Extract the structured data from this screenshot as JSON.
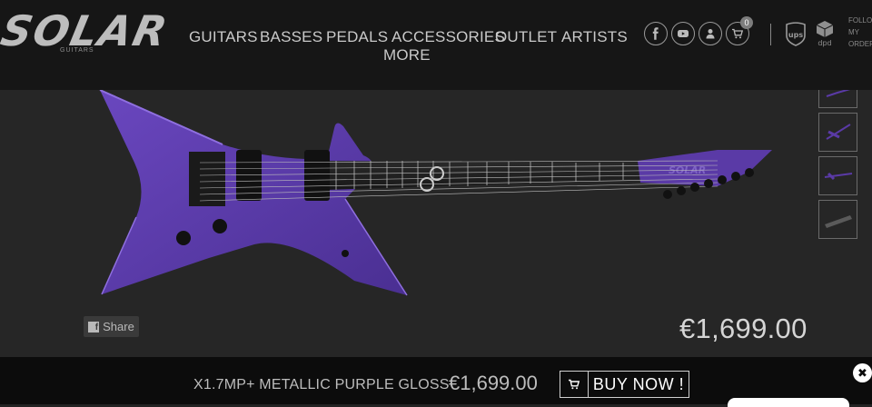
{
  "brand": {
    "logo_text": "SOLAR",
    "logo_sub": "GUITARS"
  },
  "nav": {
    "items": [
      {
        "label": "GUITARS"
      },
      {
        "label": "BASSES"
      },
      {
        "label": "PEDALS"
      },
      {
        "label": "ACCESSORIES"
      },
      {
        "label": "OUTLET"
      },
      {
        "label": "ARTISTS"
      },
      {
        "label": "MORE"
      }
    ]
  },
  "header_icons": [
    "facebook-icon",
    "youtube-icon",
    "user-icon",
    "cart-icon"
  ],
  "cart": {
    "count": "0"
  },
  "shipping": {
    "ups": "ups",
    "dpd": "dpd"
  },
  "follow": {
    "line1": "FOLLO",
    "line2": "MY",
    "line3": "ORDER"
  },
  "product": {
    "name": "X1.7MP+ METALLIC PURPLE GLOSS",
    "price": "€1,699.00",
    "headstock_logo": "SOLAR",
    "guitar_color": "#5a3aa6"
  },
  "share": {
    "label": "Share"
  },
  "cta": {
    "buy_label": "BUY NOW !"
  },
  "colors": {
    "header_bg": "#161616",
    "page_bg": "#262626",
    "bar_bg": "#0c0c0c",
    "accent": "#5a3aa6"
  }
}
